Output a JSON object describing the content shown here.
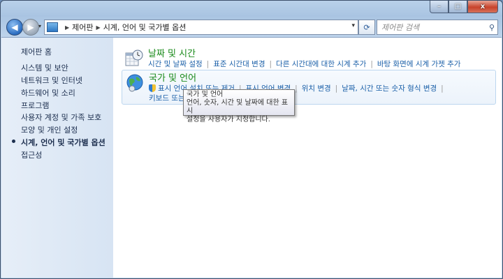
{
  "window": {
    "minimize": "–",
    "maximize": "□",
    "close": "x"
  },
  "navbar": {
    "breadcrumbs": [
      "제어판",
      "시계, 언어 및 국가별 옵션"
    ],
    "search_placeholder": "제어판 검색"
  },
  "sidebar": {
    "items": [
      {
        "label": "제어판 홈"
      },
      {
        "label": "시스템 및 보안"
      },
      {
        "label": "네트워크 및 인터넷"
      },
      {
        "label": "하드웨어 및 소리"
      },
      {
        "label": "프로그램"
      },
      {
        "label": "사용자 계정 및 가족 보호"
      },
      {
        "label": "모양 및 개인 설정"
      },
      {
        "label": "시계, 언어 및 국가별 옵션"
      },
      {
        "label": "접근성"
      }
    ]
  },
  "categories": [
    {
      "title": "날짜 및 시간",
      "links": [
        "시간 및 날짜 설정",
        "표준 시간대 변경",
        "다른 시간대에 대한 시계 추가",
        "바탕 화면에 시계 가젯 추가"
      ]
    },
    {
      "title": "국가 및 언어",
      "links": [
        "표시 언어 설치 또는 제거",
        "표시 언어 변경",
        "위치 변경",
        "날짜, 시간 또는 숫자 형식 변경"
      ],
      "links_row2": "키보드 또는"
    }
  ],
  "tooltip": {
    "title": "국가 및 언어",
    "line1": "언어, 숫자, 시간 및 날짜에 대한 표시",
    "line2": "설정을 사용자가 지정합니다."
  }
}
